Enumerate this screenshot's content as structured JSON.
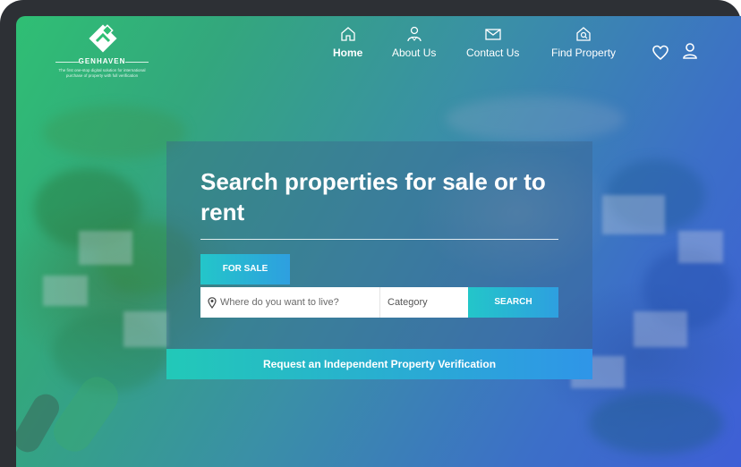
{
  "brand": {
    "name": "GENHAVEN",
    "tagline": "The first one-stop digital solution for international purchase of property with full verification"
  },
  "nav": {
    "items": [
      {
        "label": "Home",
        "icon": "home-icon",
        "active": true
      },
      {
        "label": "About Us",
        "icon": "user-icon",
        "active": false
      },
      {
        "label": "Contact Us",
        "icon": "envelope-icon",
        "active": false
      },
      {
        "label": "Find Property",
        "icon": "house-search-icon",
        "active": false
      }
    ],
    "favorites_icon": "heart-icon",
    "account_icon": "person-icon"
  },
  "hero": {
    "headline": "Search properties for sale or to rent",
    "sale_button": "FOR SALE",
    "search": {
      "location_placeholder": "Where do you want to live?",
      "location_icon": "location-pin-icon",
      "category_label": "Category",
      "search_button": "SEARCH"
    },
    "verification_link": "Request an Independent Property Verification"
  },
  "colors": {
    "accent_gradient_start": "#23c6c9",
    "accent_gradient_end": "#2e9fe0",
    "device_frame": "#2d3035",
    "background_green": "#2fbf74",
    "background_blue": "#3e5fd6"
  }
}
